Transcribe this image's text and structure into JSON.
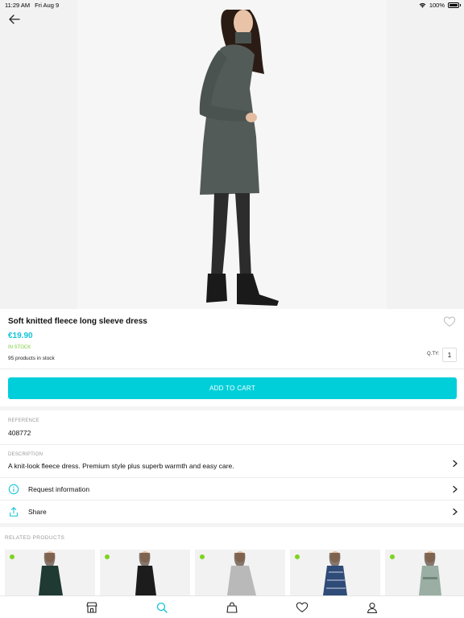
{
  "status_bar": {
    "time": "11:29 AM",
    "date": "Fri Aug 9",
    "battery": "100%"
  },
  "product": {
    "title": "Soft knitted fleece long sleeve dress",
    "price": "€19.90",
    "stock_status": "IN STOCK",
    "stock_count": "95 products in stock",
    "qty_label": "Q.TY:",
    "qty_value": "1",
    "add_to_cart": "ADD TO CART"
  },
  "details": {
    "reference_label": "REFERENCE",
    "reference_value": "408772",
    "description_label": "DESCRIPTION",
    "description_value": "A knit-look fleece dress. Premium style plus superb warmth and easy care."
  },
  "actions": {
    "request_info": "Request information",
    "share": "Share"
  },
  "related": {
    "title": "RELATED PRODUCTS",
    "items": [
      {
        "dress_color": "#1f3a33"
      },
      {
        "dress_color": "#1c1c1c"
      },
      {
        "dress_color": "#b9b9b9"
      },
      {
        "dress_color": "#2f4b78"
      },
      {
        "dress_color": "#9aaea3"
      }
    ]
  },
  "tabbar": {
    "icons": [
      "store-icon",
      "search-icon",
      "bag-icon",
      "heart-icon",
      "user-icon"
    ],
    "active": "search-icon"
  },
  "colors": {
    "accent": "#00cfda",
    "price": "#11c4d6",
    "in_stock": "#7ccc37",
    "dot": "#7ed321"
  }
}
